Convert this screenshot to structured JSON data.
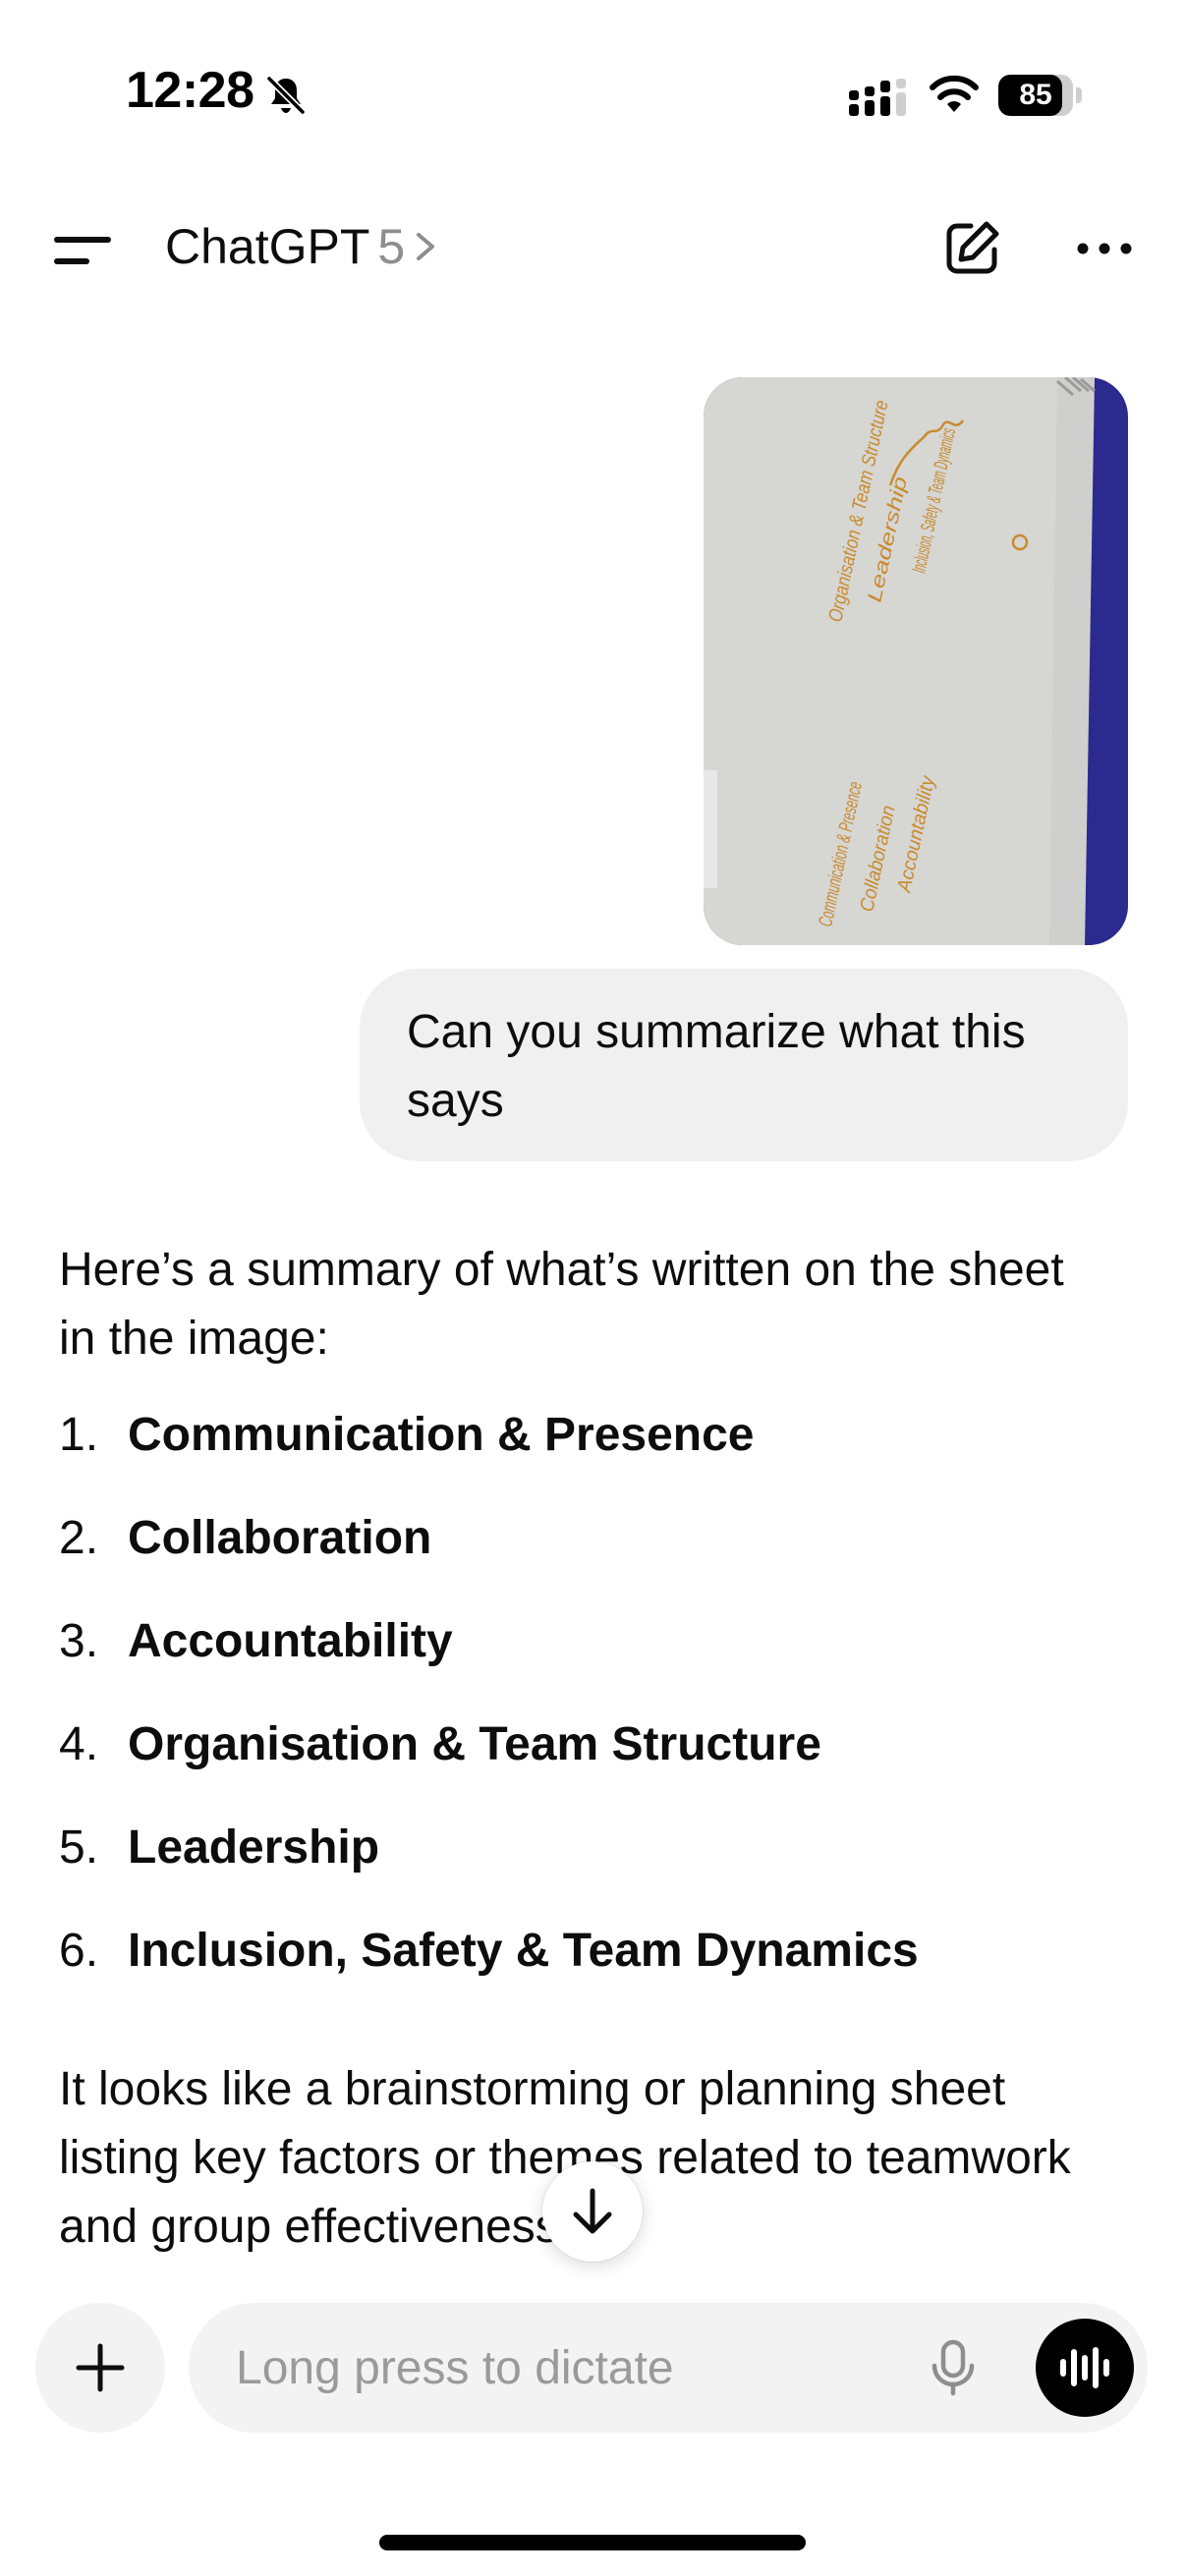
{
  "status_bar": {
    "time": "12:28",
    "battery_level": "85",
    "battery_fraction": 0.85,
    "icons": [
      "bell-slash-icon",
      "cellular-signal-icon",
      "wifi-icon",
      "battery-icon"
    ]
  },
  "header": {
    "title": "ChatGPT",
    "version": "5",
    "icons": [
      "sidebar-menu-icon",
      "chevron-right-icon",
      "new-chat-icon",
      "more-icon"
    ]
  },
  "conversation": {
    "user_image": {
      "handwritten_text": [
        "Organisation & Team Structure",
        "Leadership",
        "Inclusion, Safety & Team Dynamics",
        "Communication & Presence",
        "Collaboration",
        "Accountability"
      ]
    },
    "user_message": "Can you summarize what this says",
    "assistant": {
      "intro": "Here’s a summary of what’s written on the sheet in the image:",
      "items": [
        {
          "number": "1.",
          "text": "Communication & Presence"
        },
        {
          "number": "2.",
          "text": "Collaboration"
        },
        {
          "number": "3.",
          "text": "Accountability"
        },
        {
          "number": "4.",
          "text": "Organisation & Team Structure"
        },
        {
          "number": "5.",
          "text": "Leadership"
        },
        {
          "number": "6.",
          "text": "Inclusion, Safety & Team Dynamics"
        }
      ],
      "outro": "It looks like a brainstorming or planning sheet listing key factors or themes related to teamwork and group effectiveness."
    }
  },
  "composer": {
    "placeholder": "Long press to dictate",
    "icons": [
      "plus-icon",
      "microphone-icon",
      "voice-mode-icon",
      "arrow-down-icon"
    ]
  },
  "colors": {
    "bubble_bg": "#f0f0f0",
    "composer_bg": "#f3f3f3",
    "text": "#0d0d0d",
    "muted": "#8e8e8e",
    "handwriting": "#c98a2e",
    "background_blue": "#2b2a8f"
  }
}
